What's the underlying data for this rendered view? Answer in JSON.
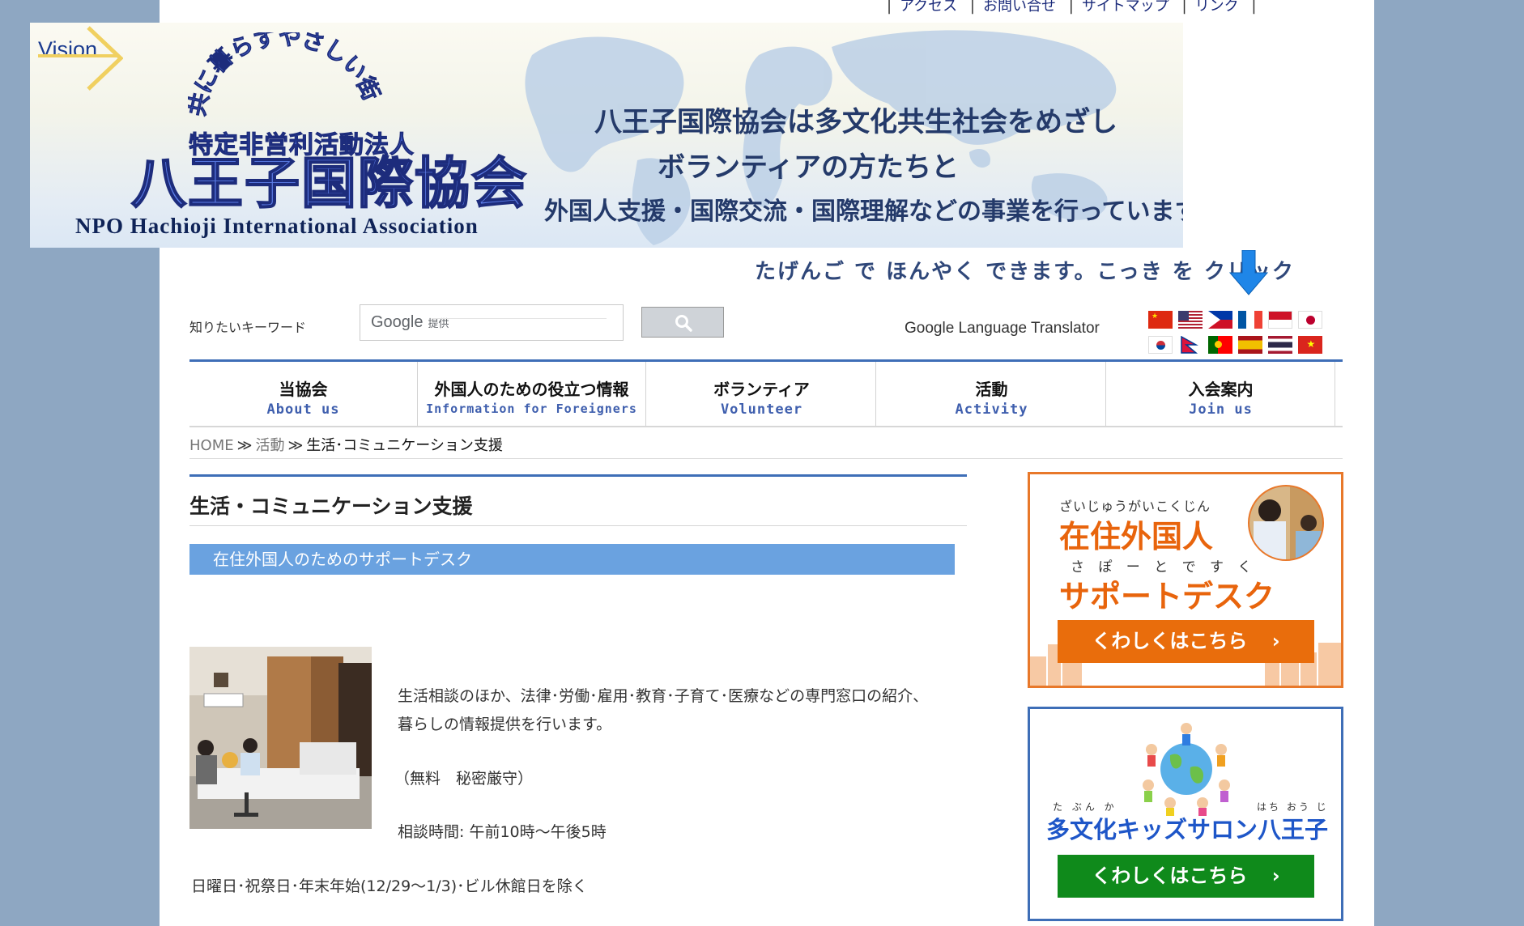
{
  "top_links": [
    "アクセス",
    "お問い合せ",
    "サイトマップ",
    "リンク"
  ],
  "banner": {
    "vision": "Vision",
    "arch_slogan": "共に暮らすやさしい街に…",
    "npo_jp": "特定非営利活動法人",
    "org_name_jp": "八王子国際協会",
    "org_name_en": "NPO Hachioji International Association",
    "tagline_1": "八王子国際協会は多文化共生社会をめざし",
    "tagline_2": "ボランティアの方たちと",
    "tagline_3": "外国人支援・国際交流・国際理解などの事業を行っています"
  },
  "translate_hint": "たげんご で ほんやく できます。こっき を クリック",
  "search": {
    "label": "知りたいキーワード",
    "google_logo": "Google",
    "provided": "提供"
  },
  "translator_label": "Google Language Translator",
  "flags": [
    "china-flag",
    "usa-flag",
    "philippines-flag",
    "france-flag",
    "indonesia-flag",
    "japan-flag",
    "korea-flag",
    "nepal-flag",
    "portugal-flag",
    "spain-flag",
    "thailand-flag",
    "vietnam-flag"
  ],
  "nav": [
    {
      "jp": "当協会",
      "en": "About us"
    },
    {
      "jp": "外国人のための役立つ情報",
      "en": "Information for Foreigners"
    },
    {
      "jp": "ボランティア",
      "en": "Volunteer"
    },
    {
      "jp": "活動",
      "en": "Activity"
    },
    {
      "jp": "入会案内",
      "en": "Join us"
    }
  ],
  "breadcrumb": {
    "home": "HOME",
    "parent": "活動",
    "current": "生活･コミュニケーション支援"
  },
  "main": {
    "title": "生活・コミュニケーション支援",
    "sub_heading": "在住外国人のためのサポートデスク",
    "para_1a": "生活相談のほか、法律･労働･雇用･教育･子育て･医療などの専門窓口の紹介、",
    "para_1b": "暮らしの情報提供を行います。",
    "para_2": "（無料　秘密厳守）",
    "para_3": "相談時間: 午前10時～午後5時",
    "para_4": "日曜日･祝祭日･年末年始(12/29～1/3)･ビル休館日を除く"
  },
  "sidebar": {
    "banner1": {
      "ruby_1": "ざいじゅうがいこくじん",
      "title_1": "在住外国人",
      "ruby_2": "さ ぽ ー と で す く",
      "title_2": "サポートデスク",
      "button": "くわしくはこちら"
    },
    "banner2": {
      "ruby_left": "た ぶん か",
      "ruby_right": "はち おう じ",
      "title": "多文化キッズサロン八王子",
      "button": "くわしくはこちら"
    }
  },
  "colors": {
    "page_bg": "#8ea7c2",
    "accent_blue": "#3e6eb7",
    "sub_bar": "#6aa2e0",
    "orange": "#e96d0c",
    "green": "#0f8a1b"
  }
}
